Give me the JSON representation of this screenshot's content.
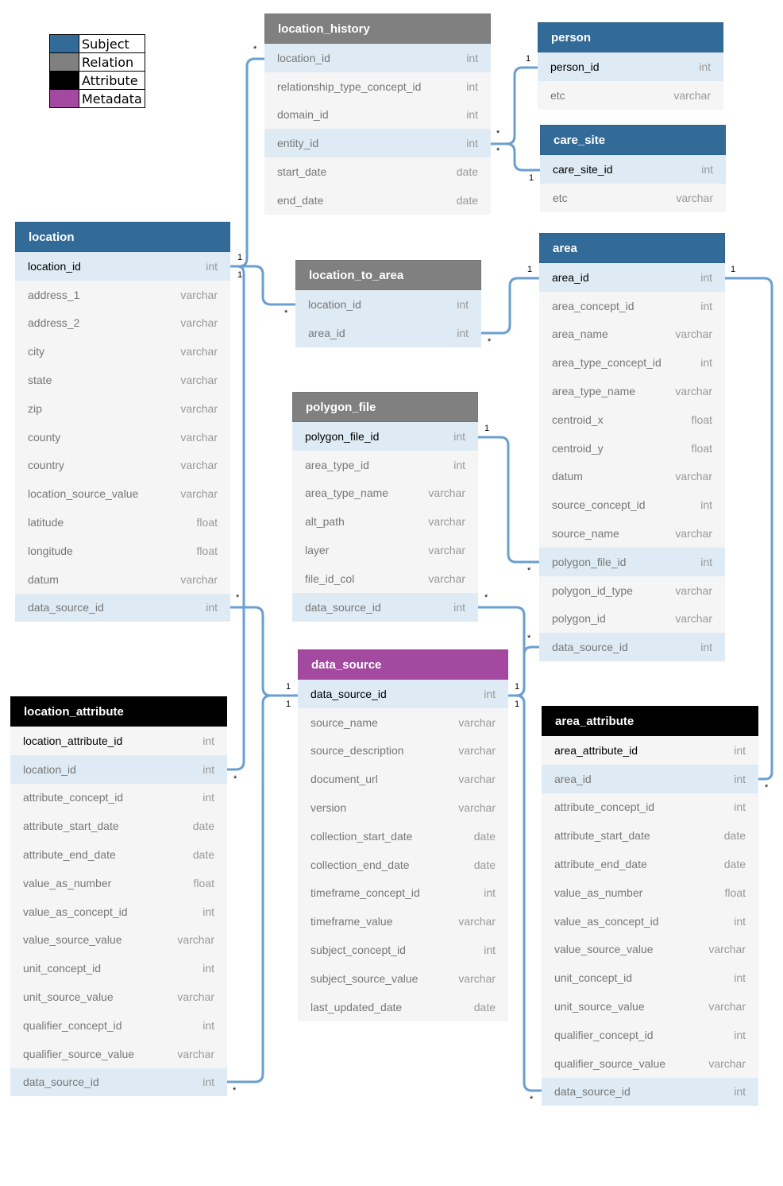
{
  "legend": [
    {
      "label": "Subject",
      "color": "#336b98"
    },
    {
      "label": "Relation",
      "color": "#808080"
    },
    {
      "label": "Attribute",
      "color": "#000000"
    },
    {
      "label": "Metadata",
      "color": "#a349a0"
    }
  ],
  "colors": {
    "subject": "#336b98",
    "relation": "#808080",
    "attribute": "#000000",
    "metadata": "#a349a0",
    "connector": "#6a9fd0",
    "linked_row": "#deebf4",
    "row": "#f5f5f5"
  },
  "tables": [
    {
      "name": "location_history",
      "kind": "relation",
      "columns": [
        {
          "name": "location_id",
          "type": "int",
          "linked": true
        },
        {
          "name": "relationship_type_concept_id",
          "type": "int"
        },
        {
          "name": "domain_id",
          "type": "int"
        },
        {
          "name": "entity_id",
          "type": "int",
          "linked": true
        },
        {
          "name": "start_date",
          "type": "date"
        },
        {
          "name": "end_date",
          "type": "date"
        }
      ]
    },
    {
      "name": "person",
      "kind": "subject",
      "columns": [
        {
          "name": "person_id",
          "type": "int",
          "key": true,
          "linked": true
        },
        {
          "name": "etc",
          "type": "varchar"
        }
      ]
    },
    {
      "name": "care_site",
      "kind": "subject",
      "columns": [
        {
          "name": "care_site_id",
          "type": "int",
          "key": true,
          "linked": true
        },
        {
          "name": "etc",
          "type": "varchar"
        }
      ]
    },
    {
      "name": "location",
      "kind": "subject",
      "columns": [
        {
          "name": "location_id",
          "type": "int",
          "key": true,
          "linked": true
        },
        {
          "name": "address_1",
          "type": "varchar"
        },
        {
          "name": "address_2",
          "type": "varchar"
        },
        {
          "name": "city",
          "type": "varchar"
        },
        {
          "name": "state",
          "type": "varchar"
        },
        {
          "name": "zip",
          "type": "varchar"
        },
        {
          "name": "county",
          "type": "varchar"
        },
        {
          "name": "country",
          "type": "varchar"
        },
        {
          "name": "location_source_value",
          "type": "varchar"
        },
        {
          "name": "latitude",
          "type": "float"
        },
        {
          "name": "longitude",
          "type": "float"
        },
        {
          "name": "datum",
          "type": "varchar"
        },
        {
          "name": "data_source_id",
          "type": "int",
          "linked": true
        }
      ]
    },
    {
      "name": "location_to_area",
      "kind": "relation",
      "columns": [
        {
          "name": "location_id",
          "type": "int",
          "linked": true
        },
        {
          "name": "area_id",
          "type": "int",
          "linked": true
        }
      ]
    },
    {
      "name": "area",
      "kind": "subject",
      "columns": [
        {
          "name": "area_id",
          "type": "int",
          "key": true,
          "linked": true
        },
        {
          "name": "area_concept_id",
          "type": "int"
        },
        {
          "name": "area_name",
          "type": "varchar"
        },
        {
          "name": "area_type_concept_id",
          "type": "int"
        },
        {
          "name": "area_type_name",
          "type": "varchar"
        },
        {
          "name": "centroid_x",
          "type": "float"
        },
        {
          "name": "centroid_y",
          "type": "float"
        },
        {
          "name": "datum",
          "type": "varchar"
        },
        {
          "name": "source_concept_id",
          "type": "int"
        },
        {
          "name": "source_name",
          "type": "varchar"
        },
        {
          "name": "polygon_file_id",
          "type": "int",
          "linked": true
        },
        {
          "name": "polygon_id_type",
          "type": "varchar"
        },
        {
          "name": "polygon_id",
          "type": "varchar"
        },
        {
          "name": "data_source_id",
          "type": "int",
          "linked": true
        }
      ]
    },
    {
      "name": "polygon_file",
      "kind": "relation",
      "columns": [
        {
          "name": "polygon_file_id",
          "type": "int",
          "key": true,
          "linked": true
        },
        {
          "name": "area_type_id",
          "type": "int"
        },
        {
          "name": "area_type_name",
          "type": "varchar"
        },
        {
          "name": "alt_path",
          "type": "varchar"
        },
        {
          "name": "layer",
          "type": "varchar"
        },
        {
          "name": "file_id_col",
          "type": "varchar"
        },
        {
          "name": "data_source_id",
          "type": "int",
          "linked": true
        }
      ]
    },
    {
      "name": "data_source",
      "kind": "metadata",
      "columns": [
        {
          "name": "data_source_id",
          "type": "int",
          "key": true,
          "linked": true
        },
        {
          "name": "source_name",
          "type": "varchar"
        },
        {
          "name": "source_description",
          "type": "varchar"
        },
        {
          "name": "document_url",
          "type": "varchar"
        },
        {
          "name": "version",
          "type": "varchar"
        },
        {
          "name": "collection_start_date",
          "type": "date"
        },
        {
          "name": "collection_end_date",
          "type": "date"
        },
        {
          "name": "timeframe_concept_id",
          "type": "int"
        },
        {
          "name": "timeframe_value",
          "type": "varchar"
        },
        {
          "name": "subject_concept_id",
          "type": "int"
        },
        {
          "name": "subject_source_value",
          "type": "varchar"
        },
        {
          "name": "last_updated_date",
          "type": "date"
        }
      ]
    },
    {
      "name": "location_attribute",
      "kind": "attribute",
      "columns": [
        {
          "name": "location_attribute_id",
          "type": "int",
          "key": true
        },
        {
          "name": "location_id",
          "type": "int",
          "linked": true
        },
        {
          "name": "attribute_concept_id",
          "type": "int"
        },
        {
          "name": "attribute_start_date",
          "type": "date"
        },
        {
          "name": "attribute_end_date",
          "type": "date"
        },
        {
          "name": "value_as_number",
          "type": "float"
        },
        {
          "name": "value_as_concept_id",
          "type": "int"
        },
        {
          "name": "value_source_value",
          "type": "varchar"
        },
        {
          "name": "unit_concept_id",
          "type": "int"
        },
        {
          "name": "unit_source_value",
          "type": "varchar"
        },
        {
          "name": "qualifier_concept_id",
          "type": "int"
        },
        {
          "name": "qualifier_source_value",
          "type": "varchar"
        },
        {
          "name": "data_source_id",
          "type": "int",
          "linked": true
        }
      ]
    },
    {
      "name": "area_attribute",
      "kind": "attribute",
      "columns": [
        {
          "name": "area_attribute_id",
          "type": "int",
          "key": true
        },
        {
          "name": "area_id",
          "type": "int",
          "linked": true
        },
        {
          "name": "attribute_concept_id",
          "type": "int"
        },
        {
          "name": "attribute_start_date",
          "type": "date"
        },
        {
          "name": "attribute_end_date",
          "type": "date"
        },
        {
          "name": "value_as_number",
          "type": "float"
        },
        {
          "name": "value_as_concept_id",
          "type": "int"
        },
        {
          "name": "value_source_value",
          "type": "varchar"
        },
        {
          "name": "unit_concept_id",
          "type": "int"
        },
        {
          "name": "unit_source_value",
          "type": "varchar"
        },
        {
          "name": "qualifier_concept_id",
          "type": "int"
        },
        {
          "name": "qualifier_source_value",
          "type": "varchar"
        },
        {
          "name": "data_source_id",
          "type": "int",
          "linked": true
        }
      ]
    }
  ],
  "relationships": [
    {
      "from": "location.location_id",
      "to": "location_history.location_id",
      "from_card": "1",
      "to_card": "*"
    },
    {
      "from": "location.location_id",
      "to": "location_to_area.location_id",
      "from_card": "1",
      "to_card": "*"
    },
    {
      "from": "location.location_id",
      "to": "location_attribute.location_id",
      "from_card": "",
      "to_card": "*"
    },
    {
      "from": "data_source.data_source_id",
      "to": "location.data_source_id",
      "from_card": "1",
      "to_card": "*"
    },
    {
      "from": "data_source.data_source_id",
      "to": "location_attribute.data_source_id",
      "from_card": "1",
      "to_card": "*"
    },
    {
      "from": "person.person_id",
      "to": "location_history.entity_id",
      "from_card": "1",
      "to_card": "*"
    },
    {
      "from": "care_site.care_site_id",
      "to": "location_history.entity_id",
      "from_card": "1",
      "to_card": "*"
    },
    {
      "from": "area.area_id",
      "to": "location_to_area.area_id",
      "from_card": "1",
      "to_card": "*"
    },
    {
      "from": "polygon_file.polygon_file_id",
      "to": "area.polygon_file_id",
      "from_card": "1",
      "to_card": "*"
    },
    {
      "from": "data_source.data_source_id",
      "to": "polygon_file.data_source_id",
      "from_card": "1",
      "to_card": "*"
    },
    {
      "from": "data_source.data_source_id",
      "to": "area.data_source_id",
      "from_card": "",
      "to_card": "*"
    },
    {
      "from": "data_source.data_source_id",
      "to": "area_attribute.data_source_id",
      "from_card": "1",
      "to_card": "*"
    },
    {
      "from": "area.area_id",
      "to": "area_attribute.area_id",
      "from_card": "1",
      "to_card": "*"
    }
  ]
}
